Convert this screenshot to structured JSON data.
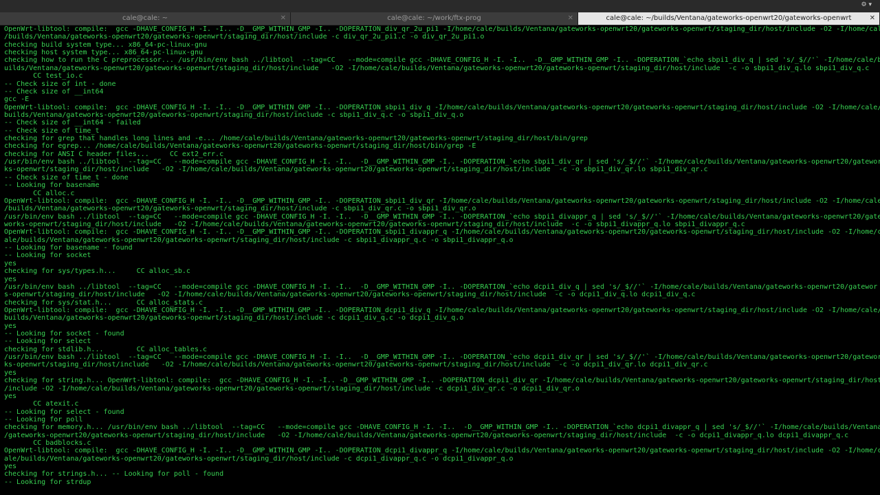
{
  "tabs": [
    {
      "title": "cale@cale: ~",
      "active": false
    },
    {
      "title": "cale@cale: ~/work/ftx-prog",
      "active": false
    },
    {
      "title": "cale@cale: ~/builds/Ventana/gateworks-openwrt20/gateworks-openwrt",
      "active": true
    }
  ],
  "colors": {
    "terminal_text": "#39d353",
    "terminal_bg": "#000000",
    "active_tab": "#e6e6e6"
  },
  "lines": [
    "OpenWrt-libtool: compile:  gcc -DHAVE_CONFIG_H -I. -I.. -D__GMP_WITHIN_GMP -I.. -DOPERATION_div_qr_2u_pi1 -I/home/cale/builds/Ventana/gateworks-openwrt20/gateworks-openwrt/staging_dir/host/include -O2 -I/home/cale/builds/Ventana/gateworks-openwrt20/gateworks-openwrt/staging_dir/host/include -c div_qr_2u_pi1.c -o div_qr_2u_pi1.o",
    "/builds/Ventana/gateworks-openwrt20/gateworks-openwrt/staging_dir/host/include -c div_qr_2u_pi1.c -o div_qr_2u_pi1.o",
    "checking build system type... x86_64-pc-linux-gnu",
    "checking host system type... x86_64-pc-linux-gnu",
    "checking how to run the C preprocessor... /usr/bin/env bash ../libtool  --tag=CC   --mode=compile gcc -DHAVE_CONFIG_H -I. -I..  -D__GMP_WITHIN_GMP -I.. -DOPERATION_`echo sbpi1_div_q | sed 's/_$//'` -I/home/cale/builds/Ventana/gateworks-openwrt20/gateworks-openwrt/staging_dir/host/include",
    "uilds/Ventana/gateworks-openwrt20/gateworks-openwrt/staging_dir/host/include   -O2 -I/home/cale/builds/Ventana/gateworks-openwrt20/gateworks-openwrt/staging_dir/host/include  -c -o sbpi1_div_q.lo sbpi1_div_q.c",
    "       CC test_io.c",
    "-- Check size of int - done",
    "-- Check size of __int64",
    "gcc -E",
    "OpenWrt-libtool: compile:  gcc -DHAVE_CONFIG_H -I. -I.. -D__GMP_WITHIN_GMP -I.. -DOPERATION_sbpi1_div_q -I/home/cale/builds/Ventana/gateworks-openwrt20/gateworks-openwrt/staging_dir/host/include -O2 -I/home/cale/",
    "builds/Ventana/gateworks-openwrt20/gateworks-openwrt/staging_dir/host/include -c sbpi1_div_q.c -o sbpi1_div_q.o",
    "-- Check size of __int64 - failed",
    "-- Check size of time_t",
    "checking for grep that handles long lines and -e... /home/cale/builds/Ventana/gateworks-openwrt20/gateworks-openwrt/staging_dir/host/bin/grep",
    "checking for egrep... /home/cale/builds/Ventana/gateworks-openwrt20/gateworks-openwrt/staging_dir/host/bin/grep -E",
    "checking for ANSI C header files...     CC ext2_err.c",
    "/usr/bin/env bash ../libtool  --tag=CC   --mode=compile gcc -DHAVE_CONFIG_H -I. -I..  -D__GMP_WITHIN_GMP -I.. -DOPERATION_`echo sbpi1_div_qr | sed 's/_$//'` -I/home/cale/builds/Ventana/gateworks-openwrt20/gateworks-openwrt/staging_dir/host/include",
    "ks-openwrt/staging_dir/host/include   -O2 -I/home/cale/builds/Ventana/gateworks-openwrt20/gateworks-openwrt/staging_dir/host/include  -c -o sbpi1_div_qr.lo sbpi1_div_qr.c",
    "-- Check size of time_t - done",
    "-- Looking for basename",
    "       CC alloc.c",
    "OpenWrt-libtool: compile:  gcc -DHAVE_CONFIG_H -I. -I.. -D__GMP_WITHIN_GMP -I.. -DOPERATION_sbpi1_div_qr -I/home/cale/builds/Ventana/gateworks-openwrt20/gateworks-openwrt/staging_dir/host/include -O2 -I/home/cale",
    "/builds/Ventana/gateworks-openwrt20/gateworks-openwrt/staging_dir/host/include -c sbpi1_div_qr.c -o sbpi1_div_qr.o",
    "/usr/bin/env bash ../libtool  --tag=CC   --mode=compile gcc -DHAVE_CONFIG_H -I. -I..  -D__GMP_WITHIN_GMP -I.. -DOPERATION_`echo sbpi1_divappr_q | sed 's/_$//'` -I/home/cale/builds/Ventana/gateworks-openwrt20/gate",
    "works-openwrt/staging_dir/host/include   -O2 -I/home/cale/builds/Ventana/gateworks-openwrt20/gateworks-openwrt/staging_dir/host/include  -c -o sbpi1_divappr_q.lo sbpi1_divappr_q.c",
    "OpenWrt-libtool: compile:  gcc -DHAVE_CONFIG_H -I. -I.. -D__GMP_WITHIN_GMP -I.. -DOPERATION_sbpi1_divappr_q -I/home/cale/builds/Ventana/gateworks-openwrt20/gateworks-openwrt/staging_dir/host/include -O2 -I/home/c",
    "ale/builds/Ventana/gateworks-openwrt20/gateworks-openwrt/staging_dir/host/include -c sbpi1_divappr_q.c -o sbpi1_divappr_q.o",
    "-- Looking for basename - found",
    "-- Looking for socket",
    "yes",
    "checking for sys/types.h...     CC alloc_sb.c",
    "yes",
    "/usr/bin/env bash ../libtool  --tag=CC   --mode=compile gcc -DHAVE_CONFIG_H -I. -I..  -D__GMP_WITHIN_GMP -I.. -DOPERATION_`echo dcpi1_div_q | sed 's/_$//'` -I/home/cale/builds/Ventana/gateworks-openwrt20/gatewor",
    "s-openwrt/staging_dir/host/include   -O2 -I/home/cale/builds/Ventana/gateworks-openwrt20/gateworks-openwrt/staging_dir/host/include  -c -o dcpi1_div_q.lo dcpi1_div_q.c",
    "checking for sys/stat.h...      CC alloc_stats.c",
    "OpenWrt-libtool: compile:  gcc -DHAVE_CONFIG_H -I. -I.. -D__GMP_WITHIN_GMP -I.. -DOPERATION_dcpi1_div_q -I/home/cale/builds/Ventana/gateworks-openwrt20/gateworks-openwrt/staging_dir/host/include -O2 -I/home/cale/",
    "builds/Ventana/gateworks-openwrt20/gateworks-openwrt/staging_dir/host/include -c dcpi1_div_q.c -o dcpi1_div_q.o",
    "yes",
    "-- Looking for socket - found",
    "-- Looking for select",
    "checking for stdlib.h...        CC alloc_tables.c",
    "/usr/bin/env bash ../libtool  --tag=CC   --mode=compile gcc -DHAVE_CONFIG_H -I. -I..  -D__GMP_WITHIN_GMP -I.. -DOPERATION_`echo dcpi1_div_qr | sed 's/_$//'` -I/home/cale/builds/Ventana/gateworks-openwrt20/gatewor",
    "ks-openwrt/staging_dir/host/include   -O2 -I/home/cale/builds/Ventana/gateworks-openwrt20/gateworks-openwrt/staging_dir/host/include  -c -o dcpi1_div_qr.lo dcpi1_div_qr.c",
    "yes",
    "checking for string.h... OpenWrt-libtool: compile:  gcc -DHAVE_CONFIG_H -I. -I.. -D__GMP_WITHIN_GMP -I.. -DOPERATION_dcpi1_div_qr -I/home/cale/builds/Ventana/gateworks-openwrt20/gateworks-openwrt/staging_dir/host",
    "/include -O2 -I/home/cale/builds/Ventana/gateworks-openwrt20/gateworks-openwrt/staging_dir/host/include -c dcpi1_div_qr.c -o dcpi1_div_qr.o",
    "yes",
    "       CC atexit.c",
    "-- Looking for select - found",
    "-- Looking for poll",
    "checking for memory.h... /usr/bin/env bash ../libtool  --tag=CC   --mode=compile gcc -DHAVE_CONFIG_H -I. -I..  -D__GMP_WITHIN_GMP -I.. -DOPERATION_`echo dcpi1_divappr_q | sed 's/_$//'` -I/home/cale/builds/Ventana",
    "/gateworks-openwrt20/gateworks-openwrt/staging_dir/host/include   -O2 -I/home/cale/builds/Ventana/gateworks-openwrt20/gateworks-openwrt/staging_dir/host/include  -c -o dcpi1_divappr_q.lo dcpi1_divappr_q.c",
    "       CC badblocks.c",
    "OpenWrt-libtool: compile:  gcc -DHAVE_CONFIG_H -I. -I.. -D__GMP_WITHIN_GMP -I.. -DOPERATION_dcpi1_divappr_q -I/home/cale/builds/Ventana/gateworks-openwrt20/gateworks-openwrt/staging_dir/host/include -O2 -I/home/c",
    "ale/builds/Ventana/gateworks-openwrt20/gateworks-openwrt/staging_dir/host/include -c dcpi1_divappr_q.c -o dcpi1_divappr_q.o",
    "yes",
    "checking for strings.h... -- Looking for poll - found",
    "-- Looking for strdup"
  ]
}
